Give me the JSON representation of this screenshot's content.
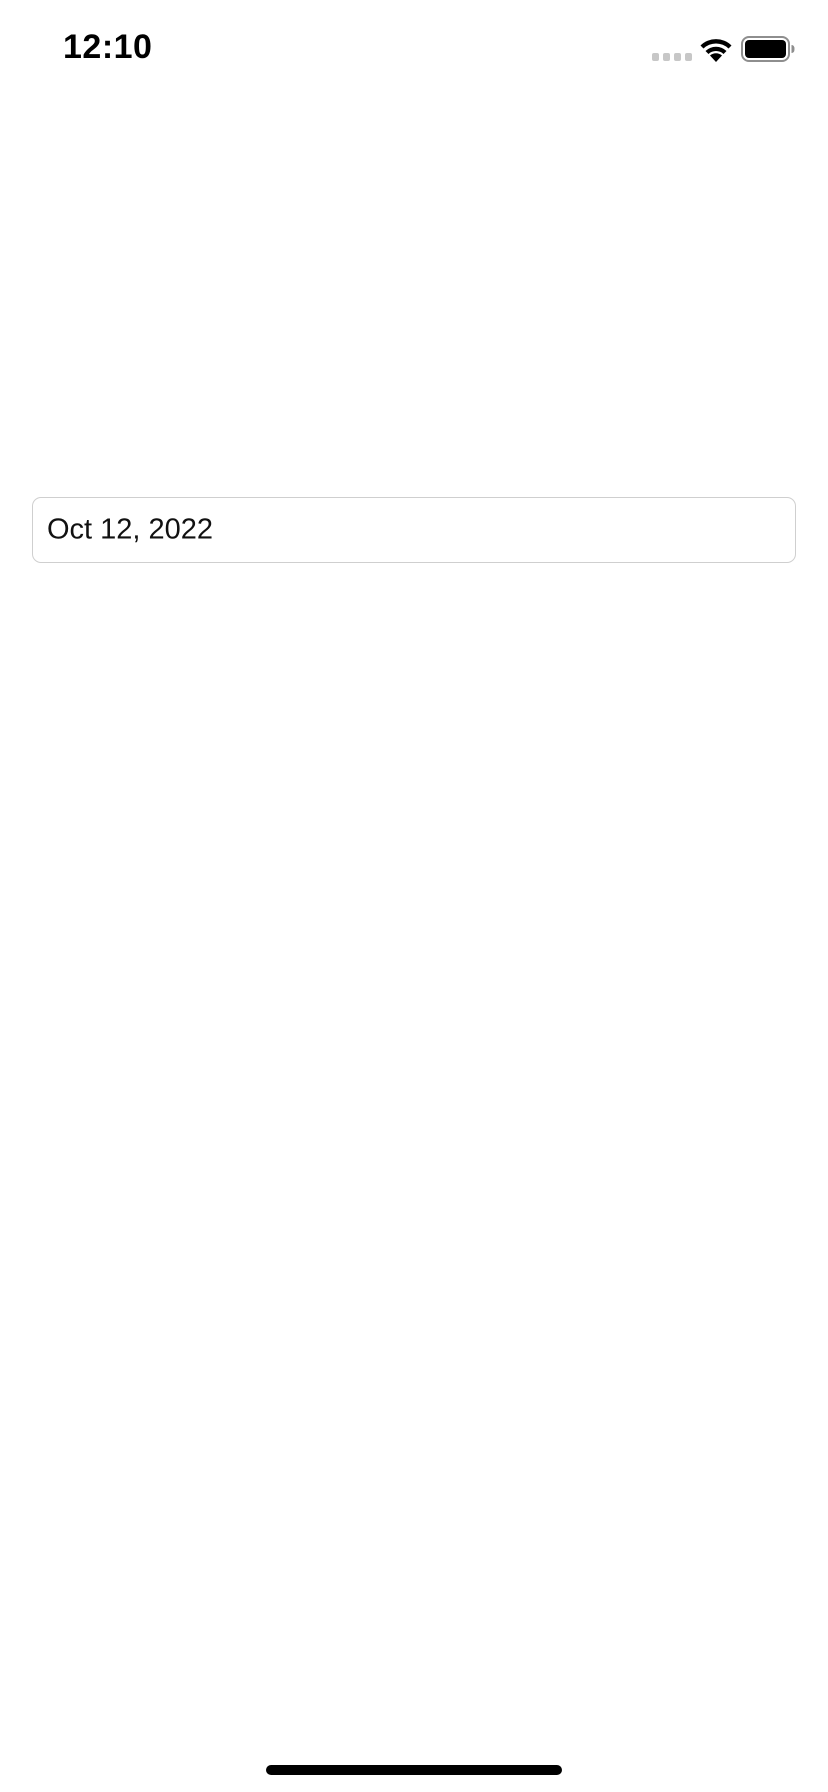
{
  "status_bar": {
    "time": "12:10",
    "signal_icon": "cellular-signal-icon",
    "wifi_icon": "wifi-icon",
    "battery_icon": "battery-icon",
    "battery_level": 1.0
  },
  "date_field": {
    "value": "Oct 12, 2022"
  },
  "colors": {
    "background": "#ffffff",
    "field_border": "#cfcfcf",
    "text": "#111111",
    "signal_inactive": "#c7c7c7"
  }
}
